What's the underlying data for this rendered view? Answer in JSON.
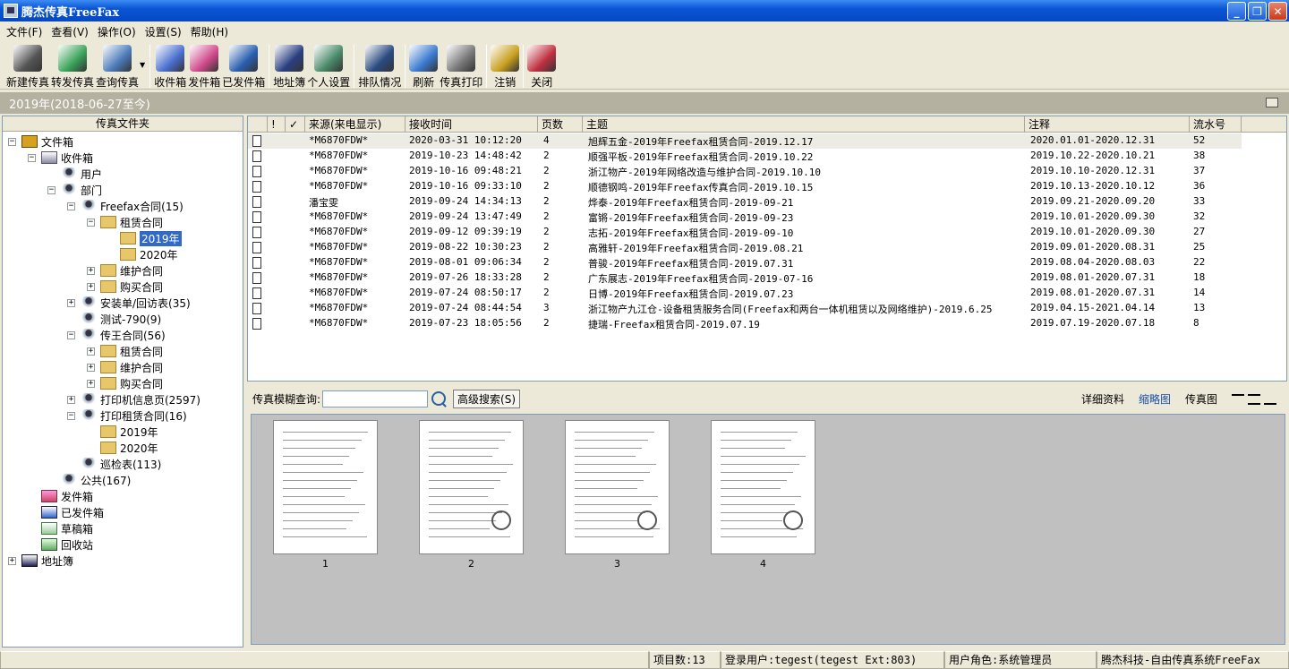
{
  "window": {
    "title": "腾杰传真FreeFax"
  },
  "menu": [
    "文件(F)",
    "查看(V)",
    "操作(O)",
    "设置(S)",
    "帮助(H)"
  ],
  "toolbar": [
    {
      "label": "新建传真",
      "icon": "fax-machine-icon",
      "color": "#555555"
    },
    {
      "label": "转发传真",
      "icon": "forward-fax-icon",
      "color": "#3aa35a"
    },
    {
      "label": "查询传真",
      "icon": "search-fax-icon",
      "color": "#4a7ab8"
    },
    {
      "label": "收件箱",
      "icon": "inbox-icon",
      "color": "#4a6fd0"
    },
    {
      "label": "发件箱",
      "icon": "outbox-icon",
      "color": "#d04a8c"
    },
    {
      "label": "已发件箱",
      "icon": "sent-box-icon",
      "color": "#2a5fb0"
    },
    {
      "label": "地址簿",
      "icon": "address-book-icon",
      "color": "#2a3f80"
    },
    {
      "label": "个人设置",
      "icon": "personal-settings-icon",
      "color": "#4a8a6a"
    },
    {
      "label": "排队情况",
      "icon": "queue-icon",
      "color": "#2a4a80"
    },
    {
      "label": "刷新",
      "icon": "refresh-icon",
      "color": "#3a7ad0"
    },
    {
      "label": "传真打印",
      "icon": "print-icon",
      "color": "#777777"
    },
    {
      "label": "注销",
      "icon": "logout-key-icon",
      "color": "#c8a020"
    },
    {
      "label": "关闭",
      "icon": "close-door-icon",
      "color": "#c03040"
    }
  ],
  "pathbar": {
    "text": "2019年(2018-06-27至今)"
  },
  "tree": {
    "header": "传真文件夹",
    "nodes": [
      {
        "label": "文件箱",
        "depth": 0,
        "exp": "-",
        "icon": "cabinet"
      },
      {
        "label": "收件箱",
        "depth": 1,
        "exp": "-",
        "icon": "inbox"
      },
      {
        "label": "用户",
        "depth": 2,
        "exp": "",
        "icon": "person"
      },
      {
        "label": "部门",
        "depth": 2,
        "exp": "-",
        "icon": "person"
      },
      {
        "label": "Freefax合同(15)",
        "depth": 3,
        "exp": "-",
        "icon": "person"
      },
      {
        "label": "租赁合同",
        "depth": 4,
        "exp": "-",
        "icon": "folder"
      },
      {
        "label": "2019年",
        "depth": 5,
        "exp": "",
        "icon": "folder",
        "selected": true
      },
      {
        "label": "2020年",
        "depth": 5,
        "exp": "",
        "icon": "folder"
      },
      {
        "label": "维护合同",
        "depth": 4,
        "exp": "+",
        "icon": "folder"
      },
      {
        "label": "购买合同",
        "depth": 4,
        "exp": "+",
        "icon": "folder"
      },
      {
        "label": "安装单/回访表(35)",
        "depth": 3,
        "exp": "+",
        "icon": "person"
      },
      {
        "label": "测试-790(9)",
        "depth": 3,
        "exp": "",
        "icon": "person"
      },
      {
        "label": "传王合同(56)",
        "depth": 3,
        "exp": "-",
        "icon": "person"
      },
      {
        "label": "租赁合同",
        "depth": 4,
        "exp": "+",
        "icon": "folder"
      },
      {
        "label": "维护合同",
        "depth": 4,
        "exp": "+",
        "icon": "folder"
      },
      {
        "label": "购买合同",
        "depth": 4,
        "exp": "+",
        "icon": "folder"
      },
      {
        "label": "打印机信息页(2597)",
        "depth": 3,
        "exp": "+",
        "icon": "person"
      },
      {
        "label": "打印租赁合同(16)",
        "depth": 3,
        "exp": "-",
        "icon": "person"
      },
      {
        "label": "2019年",
        "depth": 4,
        "exp": "",
        "icon": "folder"
      },
      {
        "label": "2020年",
        "depth": 4,
        "exp": "",
        "icon": "folder"
      },
      {
        "label": "巡检表(113)",
        "depth": 3,
        "exp": "",
        "icon": "person"
      },
      {
        "label": "公共(167)",
        "depth": 2,
        "exp": "",
        "icon": "person"
      },
      {
        "label": "发件箱",
        "depth": 1,
        "exp": "",
        "icon": "outbox"
      },
      {
        "label": "已发件箱",
        "depth": 1,
        "exp": "",
        "icon": "sent"
      },
      {
        "label": "草稿箱",
        "depth": 1,
        "exp": "",
        "icon": "draft"
      },
      {
        "label": "回收站",
        "depth": 1,
        "exp": "",
        "icon": "recycle"
      },
      {
        "label": "地址簿",
        "depth": 0,
        "exp": "+",
        "icon": "book"
      }
    ]
  },
  "list": {
    "columns": [
      "",
      "!",
      "✓",
      "来源(来电显示)",
      "接收时间",
      "页数",
      "主题",
      "注释",
      "流水号"
    ],
    "rows": [
      [
        "*M6870FDW*",
        "2020-03-31 10:12:20",
        "4",
        "  旭辉五金-2019年Freefax租赁合同-2019.12.17",
        "2020.01.01-2020.12.31",
        "52"
      ],
      [
        "*M6870FDW*",
        "2019-10-23 14:48:42",
        "2",
        "顺强平板-2019年Freefax租赁合同-2019.10.22",
        "2019.10.22-2020.10.21",
        "38"
      ],
      [
        "*M6870FDW*",
        "2019-10-16 09:48:21",
        "2",
        "  浙江物产-2019年网络改造与维护合同-2019.10.10",
        "2019.10.10-2020.12.31",
        "37"
      ],
      [
        "*M6870FDW*",
        "2019-10-16 09:33:10",
        "2",
        "  顺德钢鸣-2019年Freefax传真合同-2019.10.15",
        "2019.10.13-2020.10.12",
        "36"
      ],
      [
        "潘宝雯",
        "2019-09-24 14:34:13",
        "2",
        "烨泰-2019年Freefax租赁合同-2019-09-21",
        "2019.09.21-2020.09.20",
        "33"
      ],
      [
        "*M6870FDW*",
        "2019-09-24 13:47:49",
        "2",
        "富锵-2019年Freefax租赁合同-2019-09-23",
        "2019.10.01-2020.09.30",
        "32"
      ],
      [
        "*M6870FDW*",
        "2019-09-12 09:39:19",
        "2",
        "志拓-2019年Freefax租赁合同-2019-09-10",
        "2019.10.01-2020.09.30",
        "27"
      ],
      [
        "*M6870FDW*",
        "2019-08-22 10:30:23",
        "2",
        "高雅轩-2019年Freefax租赁合同-2019.08.21",
        "2019.09.01-2020.08.31",
        "25"
      ],
      [
        "*M6870FDW*",
        "2019-08-01 09:06:34",
        "2",
        "普骏-2019年Freefax租赁合同-2019.07.31",
        "2019.08.04-2020.08.03",
        "22"
      ],
      [
        "*M6870FDW*",
        "2019-07-26 18:33:28",
        "2",
        "广东展志-2019年Freefax租赁合同-2019-07-16",
        "2019.08.01-2020.07.31",
        "18"
      ],
      [
        "*M6870FDW*",
        "2019-07-24 08:50:17",
        "2",
        "日博-2019年Freefax租赁合同-2019.07.23",
        "2019.08.01-2020.07.31",
        "14"
      ],
      [
        "*M6870FDW*",
        "2019-07-24 08:44:54",
        "3",
        "浙江物产九江仓-设备租赁服务合同(Freefax和两台一体机租赁以及网络维护)-2019.6.25",
        "2019.04.15-2021.04.14",
        "13"
      ],
      [
        "*M6870FDW*",
        "2019-07-23 18:05:56",
        "2",
        "捷瑞-Freefax租赁合同-2019.07.19",
        "2019.07.19-2020.07.18",
        "8"
      ]
    ]
  },
  "search": {
    "label": "传真模糊查询:",
    "placeholder": "",
    "advanced": "高级搜索(S)",
    "tabs": [
      "详细资料",
      "缩略图",
      "传真图"
    ],
    "active_tab": "缩略图"
  },
  "thumbs": [
    "1",
    "2",
    "3",
    "4"
  ],
  "status": {
    "count": "项目数:13",
    "user": "登录用户:tegest(tegest Ext:803)",
    "role": "用户角色:系统管理员",
    "brand": "腾杰科技-自由传真系统FreeFax"
  }
}
